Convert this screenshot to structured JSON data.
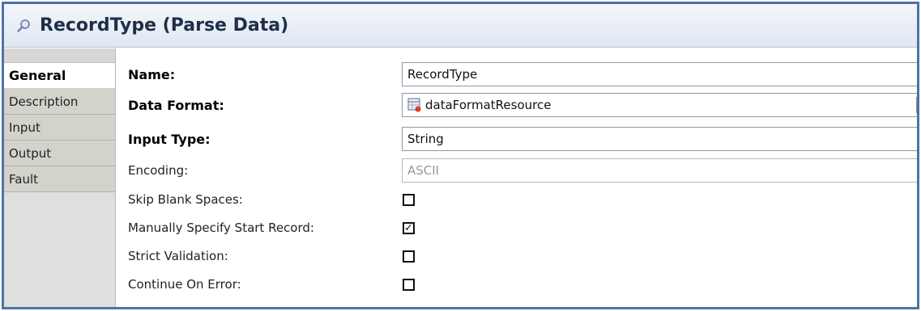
{
  "window": {
    "title": "RecordType (Parse Data)",
    "icon": "magnifier-icon"
  },
  "sidebar": {
    "tabs": [
      {
        "label": "General",
        "active": true
      },
      {
        "label": "Description",
        "active": false
      },
      {
        "label": "Input",
        "active": false
      },
      {
        "label": "Output",
        "active": false
      },
      {
        "label": "Fault",
        "active": false
      }
    ]
  },
  "form": {
    "name": {
      "label": "Name:",
      "value": "RecordType"
    },
    "data_format": {
      "label": "Data Format:",
      "value": "dataFormatResource",
      "icon": "data-format-resource-icon"
    },
    "input_type": {
      "label": "Input Type:",
      "value": "String"
    },
    "encoding": {
      "label": "Encoding:",
      "value": "ASCII",
      "disabled": true
    },
    "skip_blank_spaces": {
      "label": "Skip Blank Spaces:",
      "checked": false
    },
    "manually_specify_start_record": {
      "label": "Manually Specify Start Record:",
      "checked": true
    },
    "strict_validation": {
      "label": "Strict Validation:",
      "checked": false
    },
    "continue_on_error": {
      "label": "Continue On Error:",
      "checked": false
    }
  },
  "colors": {
    "border": "#4f72a8",
    "titlebar": "#dfe7f1",
    "tab_bg": "#d3d2cb"
  },
  "glyphs": {
    "check": "✓",
    "dropdown": "▼"
  }
}
